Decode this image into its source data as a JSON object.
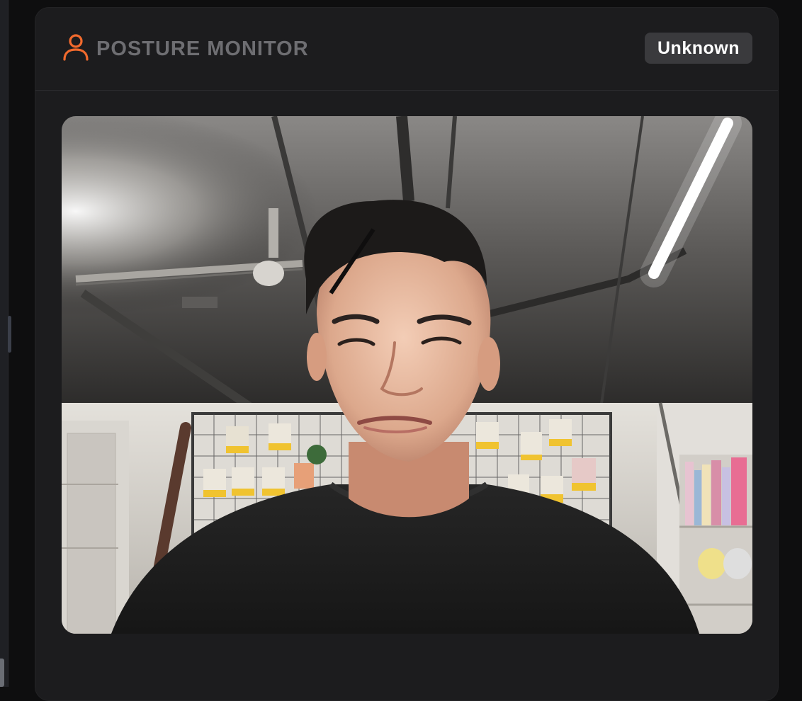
{
  "panel": {
    "title": "POSTURE MONITOR",
    "icon": "person-icon",
    "status": "Unknown",
    "accent_color": "#f26a2d"
  },
  "camera": {
    "feed": "camera-feed"
  }
}
